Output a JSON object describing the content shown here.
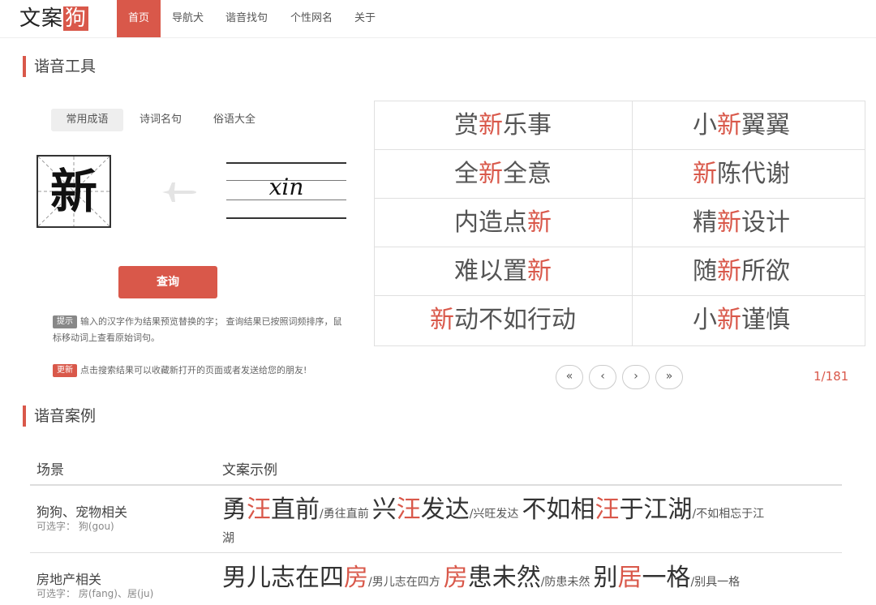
{
  "nav": {
    "logo_pre": "文案",
    "logo_hl": "狗",
    "items": [
      "首页",
      "导航犬",
      "谐音找句",
      "个性网名",
      "关于"
    ]
  },
  "tool": {
    "title": "谐音工具",
    "tabs": [
      "常用成语",
      "诗词名句",
      "俗语大全"
    ],
    "char": "新",
    "pinyin": "xin",
    "query_label": "查询",
    "tip_tag": "提示",
    "tip_text_1": "输入的汉字作为结果预览替换的字； 查询结果已按照词频排序，鼠",
    "tip_text_2": "标移动词上查看原始词句。",
    "update_tag": "更新",
    "update_text": "点击搜索结果可以收藏新打开的页面或者发送给您的朋友!"
  },
  "results": [
    {
      "a": "赏",
      "h": "新",
      "b": "乐事"
    },
    {
      "a": "小",
      "h": "新",
      "b": "翼翼"
    },
    {
      "a": "全",
      "h": "新",
      "b": "全意"
    },
    {
      "a": "",
      "h": "新",
      "b": "陈代谢"
    },
    {
      "a": "内造点",
      "h": "新",
      "b": ""
    },
    {
      "a": "精",
      "h": "新",
      "b": "设计"
    },
    {
      "a": "难以置",
      "h": "新",
      "b": ""
    },
    {
      "a": "随",
      "h": "新",
      "b": "所欲"
    },
    {
      "a": "",
      "h": "新",
      "b": "动不如行动"
    },
    {
      "a": "小",
      "h": "新",
      "b": "谨慎"
    }
  ],
  "pager": {
    "buttons": [
      "«",
      "‹",
      "›",
      "»"
    ],
    "page_text": "1/181"
  },
  "cases": {
    "title": "谐音案例",
    "col_scene": "场景",
    "col_examples": "文案示例",
    "rows": [
      {
        "scene": "狗狗、宠物相关",
        "sub": "可选字：  狗(gou)",
        "examples": [
          {
            "a": "勇",
            "h": "汪",
            "b": "直前",
            "orig": "/勇往直前"
          },
          {
            "a": "兴",
            "h": "汪",
            "b": "发达",
            "orig": "/兴旺发达"
          },
          {
            "a": "不如相",
            "h": "汪",
            "b": "于江湖",
            "orig": "/不如相忘于江"
          }
        ],
        "wrap": "湖"
      },
      {
        "scene": "房地产相关",
        "sub": "可选字：  房(fang)、居(ju)",
        "examples": [
          {
            "a": "男儿志在四",
            "h": "房",
            "b": "",
            "orig": "/男儿志在四方"
          },
          {
            "a": "",
            "h": "房",
            "b": "患未然",
            "orig": "/防患未然"
          },
          {
            "a": "别",
            "h": "居",
            "b": "一格",
            "orig": "/别具一格"
          }
        ]
      }
    ]
  }
}
